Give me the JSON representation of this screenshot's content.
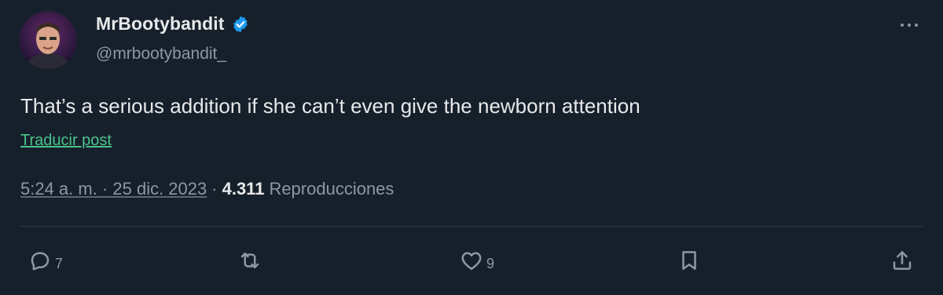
{
  "author": {
    "display_name": "MrBootybandit",
    "handle": "@mrbootybandit_",
    "verified": true
  },
  "post": {
    "text": "That’s a serious addition if she can’t even give the newborn attention",
    "translate_label": "Traducir post",
    "timestamp": "5:24 a. m. · 25 dic. 2023",
    "separator": "·",
    "views_count": "4.311",
    "views_label": "Reproducciones"
  },
  "actions": {
    "replies": "7",
    "reposts": "",
    "likes": "9"
  },
  "colors": {
    "background": "#16202b",
    "text": "#e7e9ea",
    "muted": "#8b98a5",
    "verified": "#1d9bf0",
    "translate_link": "#4cc38a"
  },
  "icons": {
    "verified": "verified-badge-icon",
    "more": "more-icon",
    "reply": "reply-icon",
    "repost": "repost-icon",
    "like": "heart-icon",
    "bookmark": "bookmark-icon",
    "share": "share-icon"
  }
}
